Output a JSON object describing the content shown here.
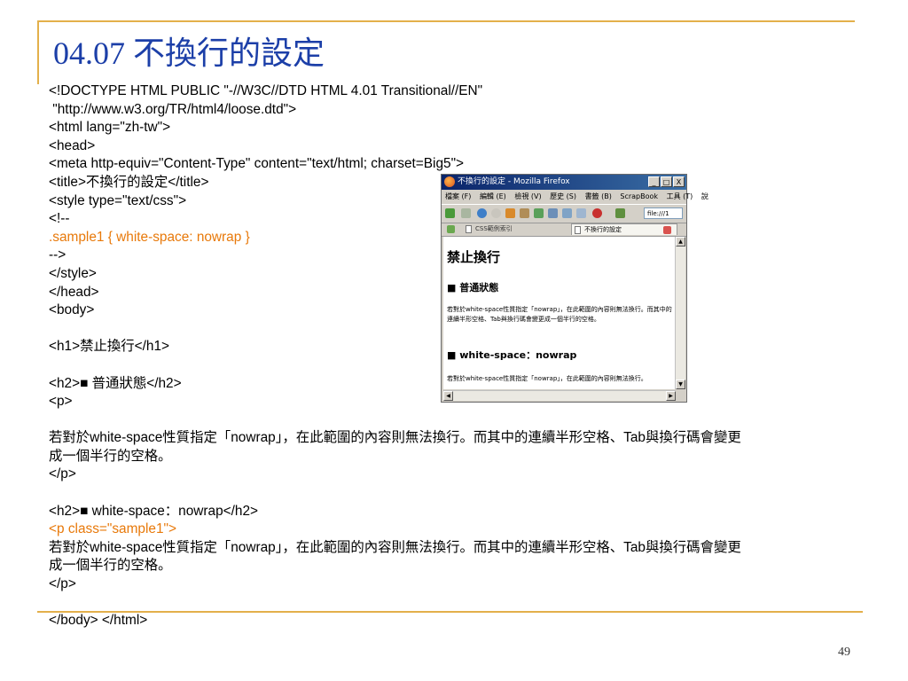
{
  "slide": {
    "title": "04.07 不換行的設定",
    "page_number": "49"
  },
  "code_lines": [
    "<!DOCTYPE HTML PUBLIC \"-//W3C//DTD HTML 4.01 Transitional//EN\"",
    " \"http://www.w3.org/TR/html4/loose.dtd\">",
    "<html lang=\"zh-tw\">",
    "<head>",
    "<meta http-equiv=\"Content-Type\" content=\"text/html; charset=Big5\">",
    "<title>不換行的設定</title>",
    "<style type=\"text/css\">",
    "<!--",
    ".sample1 { white-space: nowrap }",
    "-->",
    "</style>",
    "</head>",
    "<body>",
    "",
    "<h1>禁止換行</h1>",
    "",
    "<h2>■ 普通狀態</h2>",
    "<p>",
    "",
    "若對於white-space性質指定「nowrap」，在此範圍的內容則無法換行。而其中的連續半形空格、Tab與換行碼會變更",
    "成一個半行的空格。",
    "</p>",
    "",
    "<h2>■ white-space：nowrap</h2>",
    "<p class=\"sample1\">",
    "若對於white-space性質指定「nowrap」，在此範圍的內容則無法換行。而其中的連續半形空格、Tab與換行碼會變更",
    "成一個半行的空格。",
    "</p>",
    "",
    "</body> </html>"
  ],
  "highlight_color": "#e8790a",
  "browser": {
    "window_title": "不換行的設定 - Mozilla Firefox",
    "controls": [
      "_",
      "□",
      "X"
    ],
    "menu": [
      "檔案 (F)",
      "編輯 (E)",
      "檢視 (V)",
      "歷史 (S)",
      "書籤 (B)",
      "ScrapBook",
      "工具 (T)",
      "說"
    ],
    "url": "file:///1",
    "tabs": [
      "CSS範例索引",
      "不換行的設定"
    ],
    "content": {
      "h1": "禁止換行",
      "h2a": "■ 普通狀態",
      "p1": "若對於white-space性質指定「nowrap」，在此範圍的內容則無法換行。而其中的連續半形空格、Tab與換行碼會變更成一個半行的空格。",
      "h2b": "■ white-space：nowrap",
      "p2": "若對於white-space性質指定「nowrap」，在此範圍的內容則無法換行。"
    }
  }
}
